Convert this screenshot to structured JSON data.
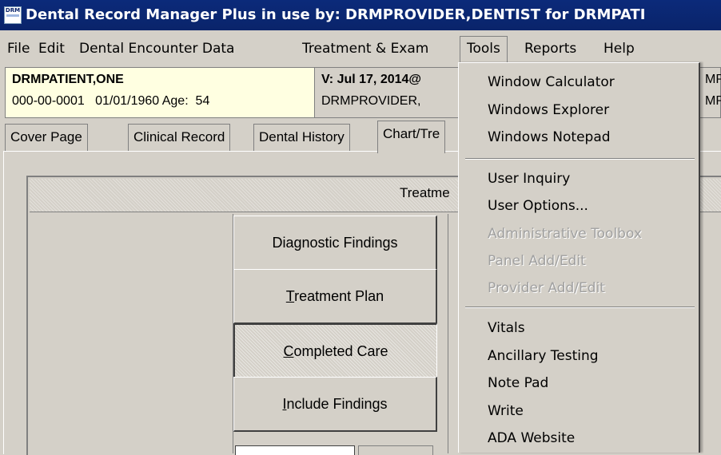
{
  "window": {
    "title": "Dental Record Manager Plus in use by: DRMPROVIDER,DENTIST for DRMPATI",
    "logo_text": "DRM"
  },
  "menubar": {
    "items": [
      "File",
      "Edit",
      "Dental Encounter Data",
      "Treatment & Exam",
      "Tools",
      "Reports",
      "Help"
    ]
  },
  "patient": {
    "name": "DRMPATIENT,ONE",
    "ssn": "000-00-0001",
    "dob": "01/01/1960",
    "age_label": "Age:",
    "age": "54"
  },
  "visit": {
    "line1": "V: Jul 17, 2014@",
    "line2": "DRMPROVIDER,"
  },
  "tabs": [
    "Cover Page",
    "Clinical Record",
    "Dental History",
    "Chart/Tre"
  ],
  "treatment": {
    "header_label": "Treatme",
    "buttons": [
      {
        "label": "Diagnostic Findings",
        "underline": ""
      },
      {
        "label_pre": "",
        "underline": "T",
        "label_post": "reatment Plan"
      },
      {
        "label_pre": "",
        "underline": "C",
        "label_post": "ompleted Care"
      },
      {
        "label_pre": "",
        "underline": "I",
        "label_post": "nclude Findings"
      }
    ]
  },
  "tools_menu": {
    "group1": [
      "Window Calculator",
      "Windows Explorer",
      "Windows Notepad"
    ],
    "group2": [
      "User Inquiry",
      "User Options...",
      "Administrative Toolbox",
      "Panel Add/Edit",
      "Provider Add/Edit"
    ],
    "group3": [
      "Vitals",
      "Ancillary Testing",
      "Note Pad",
      "Write",
      "ADA Website"
    ]
  },
  "peek": {
    "right_line1": "MP",
    "right_line2": "MP",
    "colon": ":"
  }
}
